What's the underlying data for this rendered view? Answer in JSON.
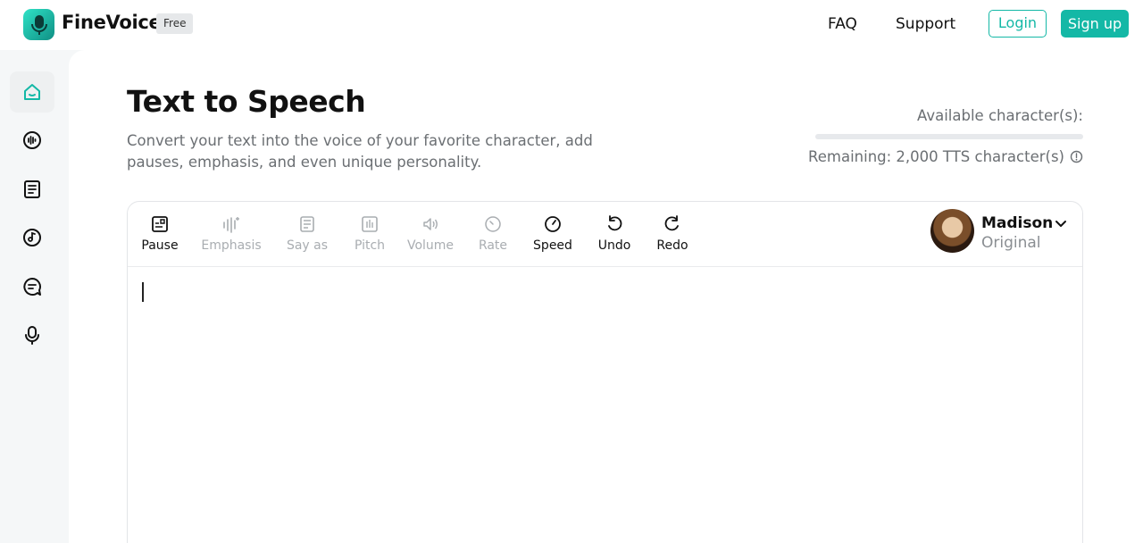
{
  "header": {
    "brand": "FineVoice",
    "badge": "Free",
    "nav": {
      "faq": "FAQ",
      "support": "Support"
    },
    "login_label": "Login",
    "signup_label": "Sign up"
  },
  "sidebar": {
    "items": [
      {
        "icon": "home-icon",
        "active": true
      },
      {
        "icon": "voice-wave-icon",
        "active": false
      },
      {
        "icon": "document-icon",
        "active": false
      },
      {
        "icon": "music-disc-icon",
        "active": false
      },
      {
        "icon": "chat-icon",
        "active": false
      },
      {
        "icon": "microphone-icon",
        "active": false
      }
    ]
  },
  "main": {
    "title": "Text to Speech",
    "subtitle": "Convert your text into the voice of your favorite character, add pauses, emphasis, and even unique personality.",
    "available_label": "Available character(s):",
    "remaining_label": "Remaining: 2,000 TTS character(s)"
  },
  "toolbar": {
    "pause": "Pause",
    "emphasis": "Emphasis",
    "say_as": "Say as",
    "pitch": "Pitch",
    "volume": "Volume",
    "rate": "Rate",
    "speed": "Speed",
    "undo": "Undo",
    "redo": "Redo"
  },
  "voice": {
    "name": "Madison",
    "style": "Original"
  },
  "colors": {
    "accent": "#14b8a6",
    "disabled_text": "#a9adb1",
    "muted_text": "#6b6f73"
  }
}
